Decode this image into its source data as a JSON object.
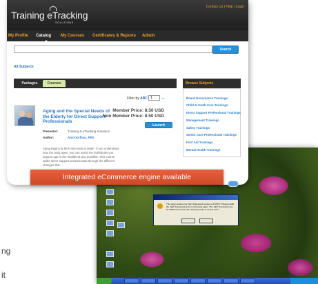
{
  "header": {
    "logo_text": "Training eTracking",
    "logo_sub": "SOLUTIONS",
    "top_links": "Contact Us | Help | Login"
  },
  "nav": {
    "items": [
      {
        "label": "My Profile"
      },
      {
        "label": "Catalog"
      },
      {
        "label": "My Courses"
      },
      {
        "label": "Certificates & Reports"
      },
      {
        "label": "Admin"
      }
    ]
  },
  "search": {
    "placeholder": "",
    "button_label": "Search"
  },
  "all_subjects": "All Subjects",
  "tabs": [
    "Packages",
    "Courses"
  ],
  "filter": {
    "label": "Filter by",
    "abc": "ABC",
    "page": "1",
    "go": ">>"
  },
  "course": {
    "title": "Aging and the Special Needs of the Elderly for Direct Support Professionals",
    "member_price": "Member Price: 8.50 USD",
    "nonmember_price": "Non Member Price: 8.50 USD",
    "launch_label": "Launch",
    "presenter_label": "Presenter:",
    "presenter": "Training & eTracking Solutions",
    "author_label": "Author:",
    "author": "Ann Dorlhan, PhD",
    "description": "Aging begins at birth and ends at death. If you understand how the body ages, you can assist the individuals you support age in the healthiest way possible. This course walks direct support professionals through the different changes that"
  },
  "browse": {
    "heading": "Browse Subjects",
    "items": [
      "Board Governance Trainings",
      "Child & Youth Care Trainings",
      "Direct Support Professional Trainings",
      "Management Trainings",
      "Safety Trainings",
      "Senior Care Professional Trainings",
      "First Aid Trainings",
      "Mental Health Trainings"
    ]
  },
  "banner": "Integrated eCommerce engine available",
  "desktop": {
    "dialog_message": "This setup requires the .NET Framework version 2.0.50727. Please install the .NET Framework and run this setup again. The .NET Framework can be obtained from the web. Would you like to do this now?",
    "dialog_yes": "Yes",
    "dialog_no": "No"
  },
  "partial_text": {
    "line1": "ng",
    "line2": "it"
  }
}
